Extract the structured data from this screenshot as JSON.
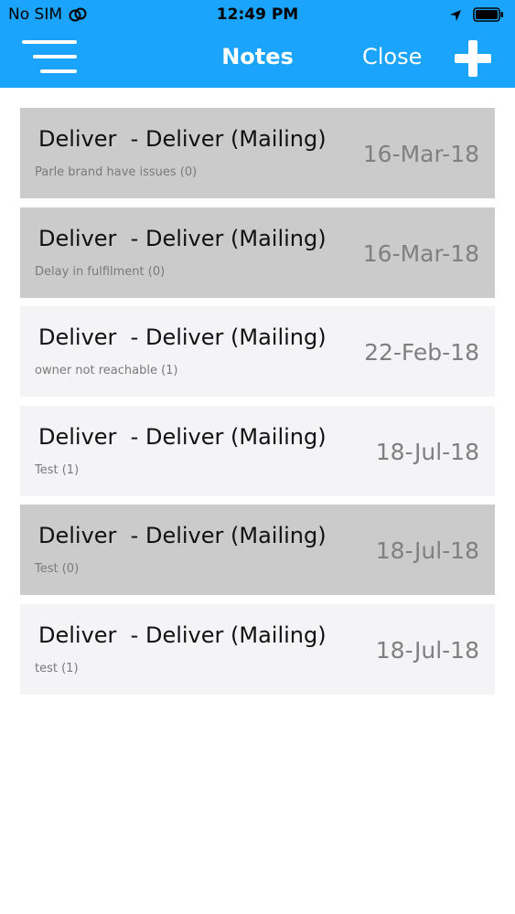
{
  "status_bar": {
    "carrier": "No SIM",
    "time": "12:49 PM"
  },
  "nav": {
    "title": "Notes",
    "close_label": "Close",
    "menu_icon": "hamburger-menu-icon",
    "add_icon": "plus-icon"
  },
  "colors": {
    "header": "#1aa4fb",
    "row_highlight": "#cbcbcb",
    "row_default": "#f4f4f6"
  },
  "notes": [
    {
      "title": "Deliver  - Deliver (Mailing)",
      "subtitle": "Parle brand have issues (0)",
      "date": "16-Mar-18",
      "highlighted": true
    },
    {
      "title": "Deliver  - Deliver (Mailing)",
      "subtitle": "Delay in fulfilment (0)",
      "date": "16-Mar-18",
      "highlighted": true
    },
    {
      "title": "Deliver  - Deliver (Mailing)",
      "subtitle": "owner not reachable (1)",
      "date": "22-Feb-18",
      "highlighted": false
    },
    {
      "title": "Deliver  - Deliver (Mailing)",
      "subtitle": "Test (1)",
      "date": "18-Jul-18",
      "highlighted": false
    },
    {
      "title": "Deliver  - Deliver (Mailing)",
      "subtitle": "Test (0)",
      "date": "18-Jul-18",
      "highlighted": true
    },
    {
      "title": "Deliver  - Deliver (Mailing)",
      "subtitle": "test (1)",
      "date": "18-Jul-18",
      "highlighted": false
    }
  ]
}
